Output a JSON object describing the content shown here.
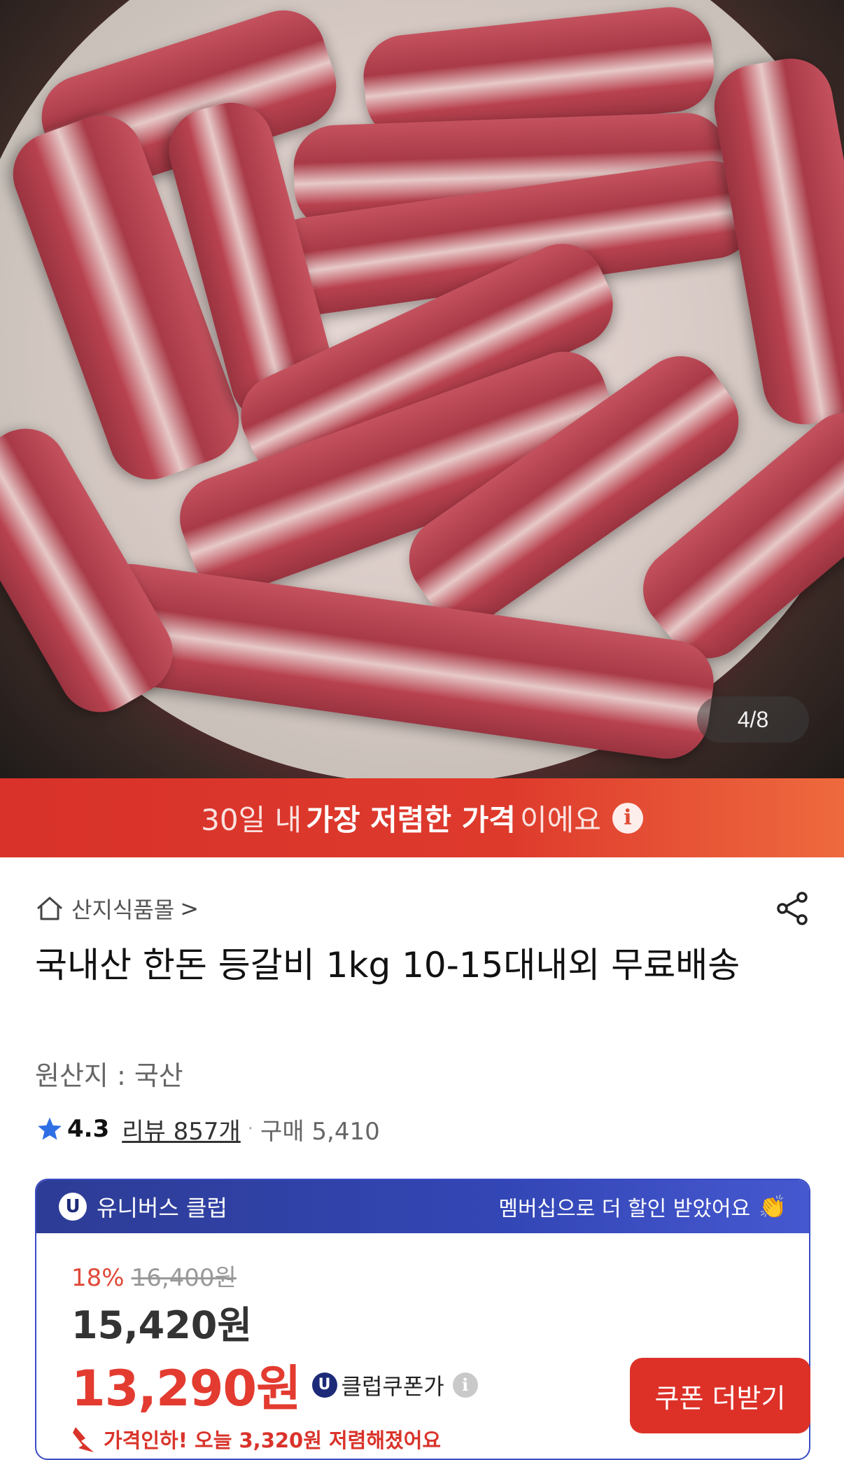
{
  "hero": {
    "image_counter": "4/8"
  },
  "banner": {
    "prefix": "30일 내",
    "highlight": "가장 저렴한 가격",
    "suffix": "이에요",
    "info_icon": "info-icon"
  },
  "store": {
    "icon": "home-icon",
    "name": "산지식품몰",
    "chevron": ">",
    "share_icon": "share-icon"
  },
  "product": {
    "title": "국내산 한돈 등갈비 1kg 10-15대내외 무료배송",
    "origin": "원산지 : 국산"
  },
  "rating": {
    "star_icon": "star-icon",
    "score": "4.3",
    "reviews": "리뷰 857개",
    "separator": "·",
    "purchases": "구매 5,410"
  },
  "club": {
    "badge": "U",
    "name": "유니버스 클럽",
    "promo": "멤버십으로 더 할인 받았어요",
    "promo_emoji": "👏",
    "discount_rate": "18%",
    "original_price": "16,400원",
    "sale_price": "15,420원",
    "coupon_price": "13,290원",
    "coupon_label": "클럽쿠폰가",
    "info": "i",
    "price_drop": "가격인하! 오늘 3,320원 저렴해졌어요",
    "more_coupon_button": "쿠폰 더받기"
  },
  "colors": {
    "banner_red": "#d8322a",
    "club_blue": "#3346b5",
    "price_red": "#e33b30",
    "button_red": "#dd3128"
  }
}
